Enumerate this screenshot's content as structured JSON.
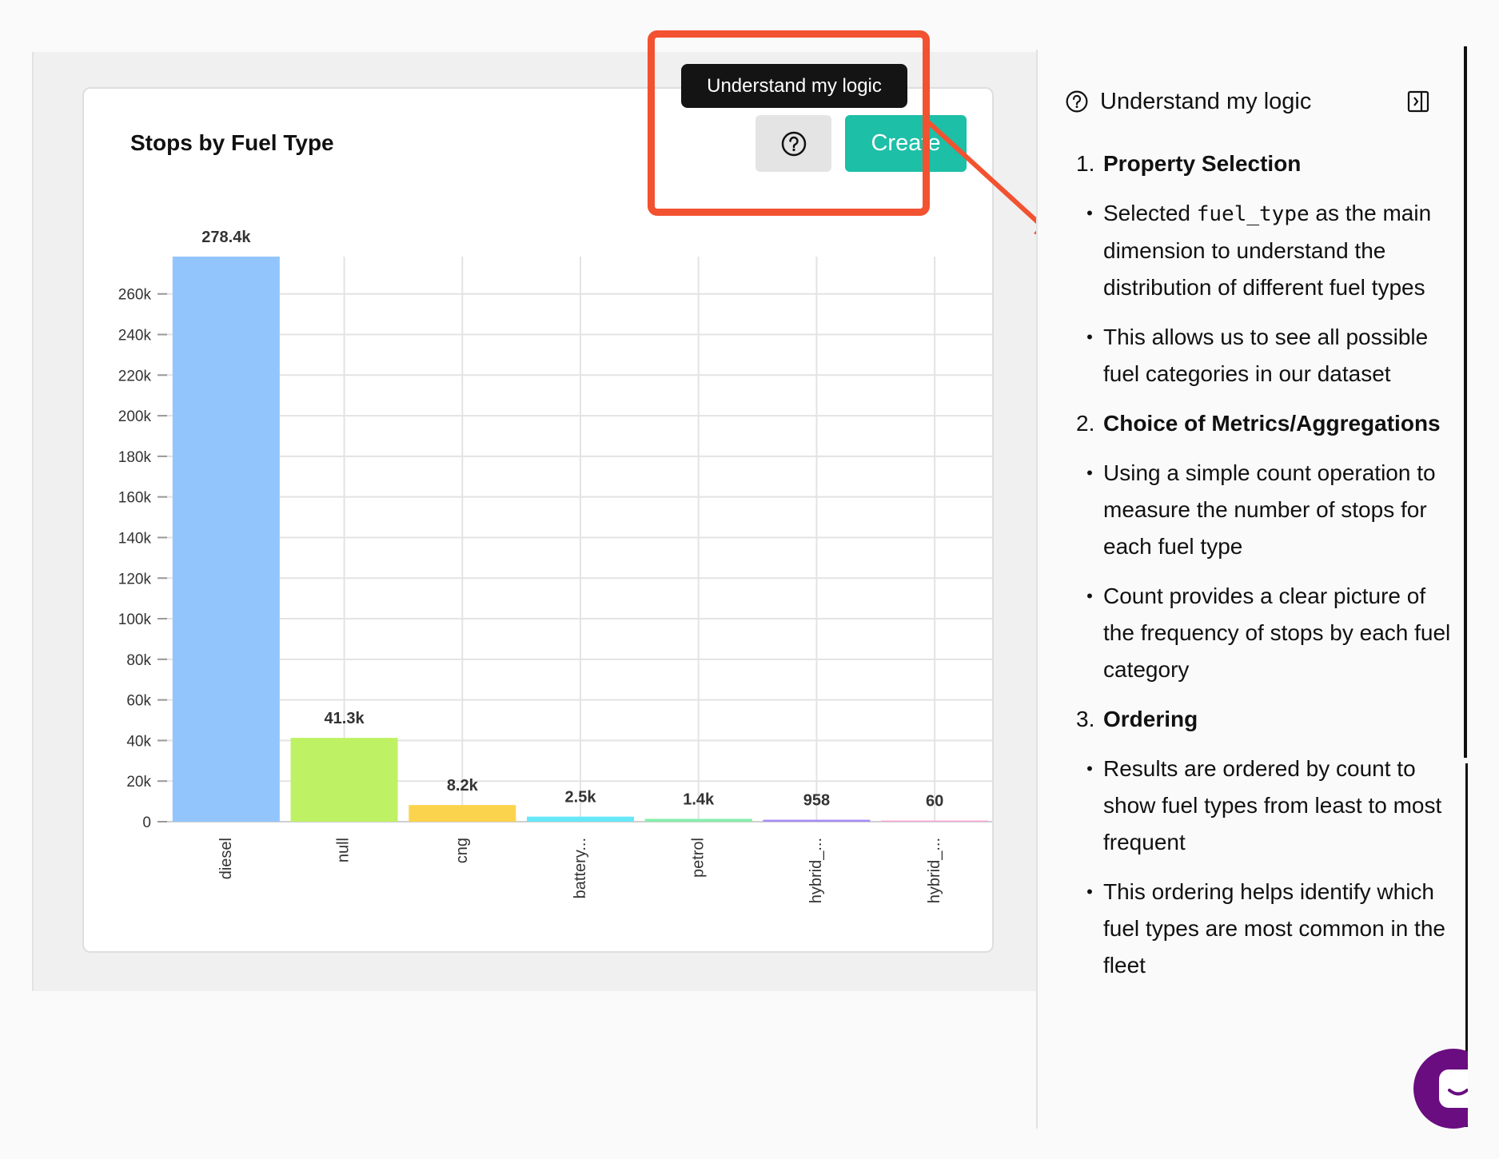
{
  "chart_card": {
    "title": "Stops by Fuel Type"
  },
  "toolbar": {
    "tooltip": "Understand my logic",
    "create_label": "Create"
  },
  "chart_data": {
    "type": "bar",
    "categories": [
      "diesel",
      "null",
      "cng",
      "battery...",
      "petrol",
      "hybrid_...",
      "hybrid_..."
    ],
    "values": [
      278400,
      41300,
      8200,
      2500,
      1400,
      958,
      60
    ],
    "data_labels": [
      "278.4k",
      "41.3k",
      "8.2k",
      "2.5k",
      "1.4k",
      "958",
      "60"
    ],
    "colors": [
      "#93c5fd",
      "#bef264",
      "#fcd34d",
      "#67e8f9",
      "#86efac",
      "#a78bfa",
      "#f9a8d4"
    ],
    "y_ticks": [
      0,
      20000,
      40000,
      60000,
      80000,
      100000,
      120000,
      140000,
      160000,
      180000,
      200000,
      220000,
      240000,
      260000
    ],
    "y_tick_labels": [
      "0",
      "20k",
      "40k",
      "60k",
      "80k",
      "100k",
      "120k",
      "140k",
      "160k",
      "180k",
      "200k",
      "220k",
      "240k",
      "260k"
    ],
    "ylim": [
      0,
      278400
    ],
    "grid": true,
    "title": "Stops by Fuel Type",
    "xlabel": "",
    "ylabel": ""
  },
  "panel": {
    "title": "Understand my logic",
    "sections": [
      {
        "num": "1.",
        "title": "Property Selection",
        "bullets": [
          {
            "pre": "Selected ",
            "code": "fuel_type",
            "post": " as the main dimension to understand the distribution of different fuel types"
          },
          {
            "pre": "This allows us to see all possible fuel categories in our dataset",
            "code": "",
            "post": ""
          }
        ]
      },
      {
        "num": "2.",
        "title": "Choice of Metrics/Aggregations",
        "bullets": [
          {
            "pre": "Using a simple count operation to measure the number of stops for each fuel type",
            "code": "",
            "post": ""
          },
          {
            "pre": "Count provides a clear picture of the frequency of stops by each fuel category",
            "code": "",
            "post": ""
          }
        ]
      },
      {
        "num": "3.",
        "title": "Ordering",
        "bullets": [
          {
            "pre": "Results are ordered by count to show fuel types from least to most frequent",
            "code": "",
            "post": ""
          },
          {
            "pre": "This ordering helps identify which fuel types are most common in the fleet",
            "code": "",
            "post": ""
          }
        ]
      }
    ]
  },
  "icons": {
    "help": "question-circle-icon",
    "collapse": "panel-collapse-icon",
    "chat": "chat-smile-icon"
  },
  "colors": {
    "accent": "#1dbfa7",
    "annotation": "#f25230",
    "chat": "#6a0d80",
    "tooltip_bg": "#141414"
  }
}
